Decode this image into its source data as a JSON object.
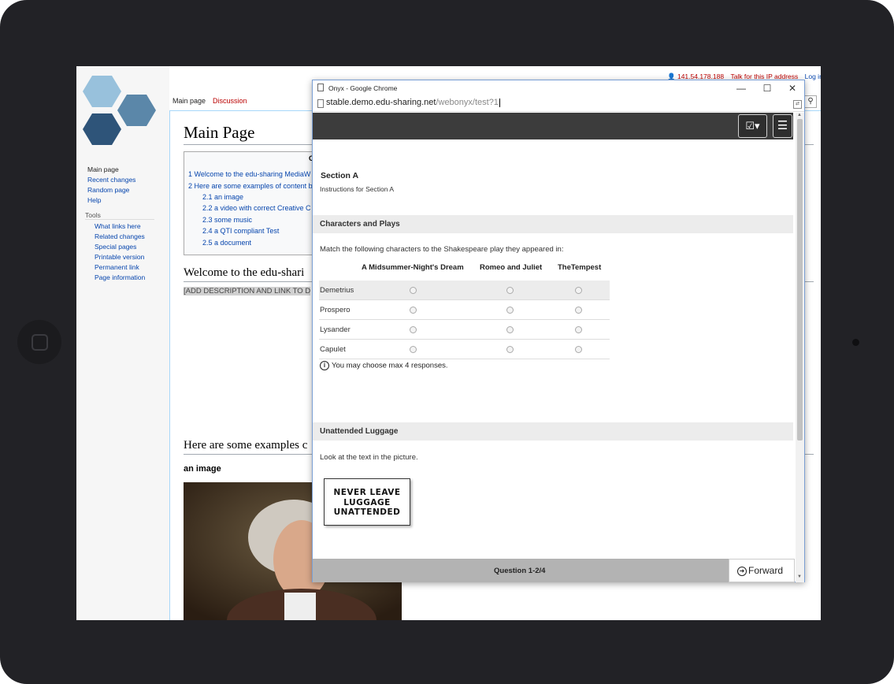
{
  "wiki": {
    "tabs": {
      "main": "Main page",
      "discussion": "Discussion"
    },
    "user_bar": {
      "ip": "141.54.178.188",
      "talk": "Talk for this IP address",
      "login": "Log in"
    },
    "sidebar": {
      "nav": [
        "Main page",
        "Recent changes",
        "Random page",
        "Help"
      ],
      "tools_heading": "Tools",
      "tools": [
        "What links here",
        "Related changes",
        "Special pages",
        "Printable version",
        "Permanent link",
        "Page information"
      ]
    },
    "title": "Main Page",
    "toc": {
      "title": "C",
      "items": [
        "1 Welcome to the edu-sharing MediaW",
        "2 Here are some examples of content b",
        "2.1 an image",
        "2.2 a video with correct Creative C",
        "2.3 some music",
        "2.4 a QTI compliant Test",
        "2.5 a document"
      ]
    },
    "welcome_heading": "Welcome to the edu-shari",
    "add_description": "[ADD DESCRIPTION AND LINK TO D",
    "examples_heading": "Here are some examples c",
    "image_heading": "an image"
  },
  "popup": {
    "window_title": "Onyx - Google Chrome",
    "controls": {
      "minimize": "—",
      "maximize": "☐",
      "close": "✕"
    },
    "address": {
      "host": "stable.demo.edu-sharing.net",
      "path": "/webonyx/test?1"
    },
    "section_title": "Section A",
    "section_instructions": "Instructions for Section A",
    "q1": {
      "heading": "Characters and Plays",
      "prompt": "Match the following characters to the Shakespeare play they appeared in:",
      "columns": [
        "A Midsummer-Night's Dream",
        "Romeo and Juliet",
        "TheTempest"
      ],
      "rows": [
        "Demetrius",
        "Prospero",
        "Lysander",
        "Capulet"
      ],
      "hint": "You may choose max 4 responses."
    },
    "q2": {
      "heading": "Unattended Luggage",
      "prompt": "Look at the text in the picture.",
      "sign_lines": [
        "NEVER LEAVE",
        "LUGGAGE",
        "UNATTENDED"
      ]
    },
    "footer": {
      "counter": "Question 1-2/4",
      "forward": "Forward"
    }
  }
}
